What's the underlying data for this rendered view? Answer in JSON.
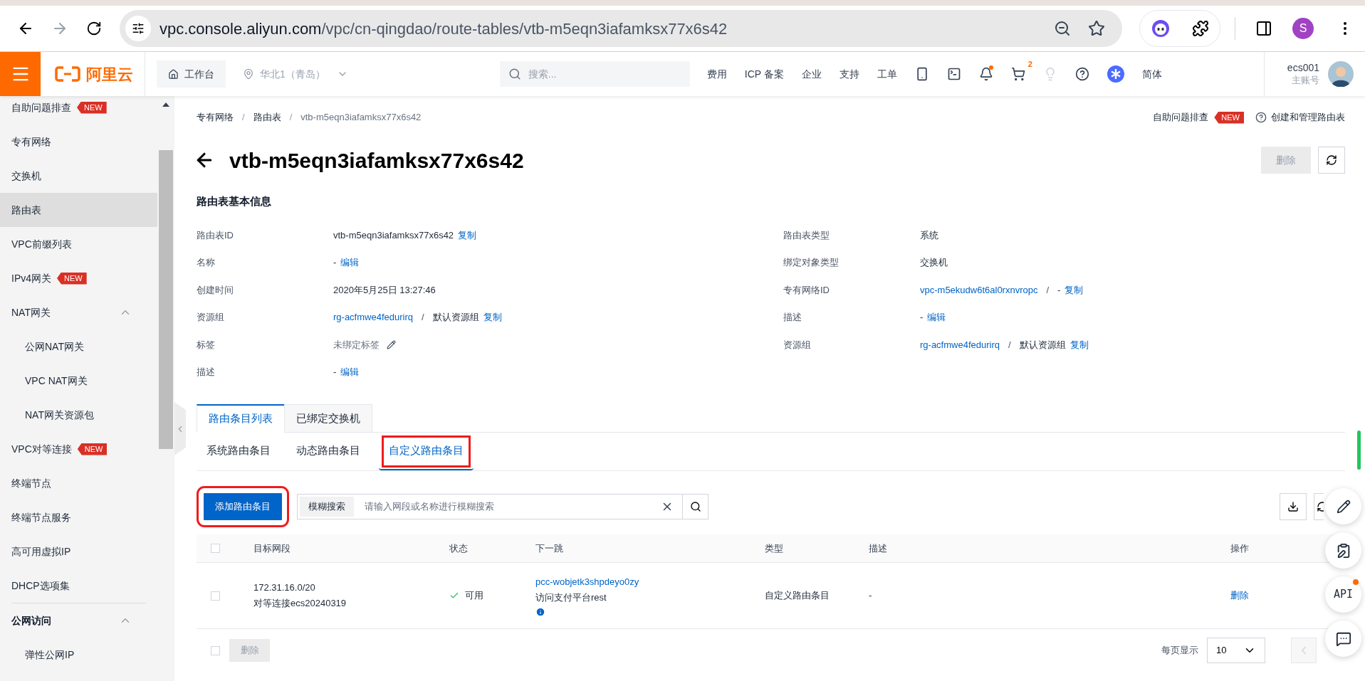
{
  "browser": {
    "url_host": "vpc.console.aliyun.com",
    "url_path": "/vpc/cn-qingdao/route-tables/vtb-m5eqn3iafamksx77x6s42",
    "forward_disabled": true,
    "profile_initial": "S"
  },
  "header": {
    "logo": "阿里云",
    "workbench": "工作台",
    "region": {
      "label": "华北1（青岛）",
      "disabled": true
    },
    "search_placeholder": "搜索...",
    "links": [
      "费用",
      "ICP 备案",
      "企业",
      "支持",
      "工单"
    ],
    "notification_dot": true,
    "cart_count": "2",
    "language": "简体",
    "user": {
      "name": "ecs001",
      "role": "主账号"
    }
  },
  "sidebar": {
    "items": [
      {
        "kind": "item",
        "label": "自助问题排查",
        "badge": "NEW",
        "selected": false
      },
      {
        "kind": "item",
        "label": "专有网络",
        "selected": false
      },
      {
        "kind": "item",
        "label": "交换机",
        "selected": false
      },
      {
        "kind": "item",
        "label": "路由表",
        "selected": true
      },
      {
        "kind": "item",
        "label": "VPC前缀列表",
        "selected": false
      },
      {
        "kind": "item",
        "label": "IPv4网关",
        "badge": "NEW",
        "selected": false
      },
      {
        "kind": "item",
        "label": "NAT网关",
        "selected": false,
        "expanded": true,
        "children": [
          {
            "label": "公网NAT网关",
            "selected": false
          },
          {
            "label": "VPC NAT网关",
            "selected": false
          },
          {
            "label": "NAT网关资源包",
            "selected": false
          }
        ]
      },
      {
        "kind": "item",
        "label": "VPC对等连接",
        "badge": "NEW",
        "selected": false
      },
      {
        "kind": "item",
        "label": "终端节点",
        "selected": false
      },
      {
        "kind": "item",
        "label": "终端节点服务",
        "selected": false
      },
      {
        "kind": "item",
        "label": "高可用虚拟IP",
        "selected": false
      },
      {
        "kind": "item",
        "label": "DHCP选项集",
        "selected": false
      },
      {
        "kind": "section",
        "label": "公网访问",
        "selected": false,
        "expanded": true,
        "children": [
          {
            "label": "弹性公网IP",
            "selected": false
          }
        ]
      }
    ]
  },
  "breadcrumb": [
    {
      "kind": "link",
      "text": "专有网络"
    },
    {
      "kind": "sep",
      "text": "/"
    },
    {
      "kind": "link",
      "text": "路由表"
    },
    {
      "kind": "sep",
      "text": "/"
    },
    {
      "kind": "current",
      "text": "vtb-m5eqn3iafamksx77x6s42"
    }
  ],
  "help": {
    "troubleshoot": "自助问题排查",
    "badge": "NEW",
    "guide": "创建和管理路由表"
  },
  "title": "vtb-m5eqn3iafamksx77x6s42",
  "delete_button": {
    "label": "删除",
    "disabled": true
  },
  "info": {
    "heading": "路由表基本信息",
    "left": [
      {
        "label": "路由表ID",
        "parts": [
          {
            "kind": "text",
            "text": "vtb-m5eqn3iafamksx77x6s42"
          },
          {
            "kind": "link",
            "text": "复制"
          }
        ]
      },
      {
        "label": "名称",
        "parts": [
          {
            "kind": "text",
            "text": "-"
          },
          {
            "kind": "link",
            "text": "编辑"
          }
        ]
      },
      {
        "label": "创建时间",
        "parts": [
          {
            "kind": "text",
            "text": "2020年5月25日 13:27:46"
          }
        ]
      },
      {
        "label": "资源组",
        "parts": [
          {
            "kind": "link",
            "text": "rg-acfmwe4fedurirq"
          },
          {
            "kind": "sep",
            "text": "/"
          },
          {
            "kind": "text",
            "text": "默认资源组"
          },
          {
            "kind": "link",
            "text": "复制"
          }
        ]
      },
      {
        "label": "标签",
        "parts": [
          {
            "kind": "muted",
            "text": "未绑定标签"
          },
          {
            "kind": "edit_icon"
          }
        ]
      },
      {
        "label": "描述",
        "parts": [
          {
            "kind": "text",
            "text": "-"
          },
          {
            "kind": "link",
            "text": "编辑"
          }
        ]
      }
    ],
    "right": [
      {
        "label": "路由表类型",
        "parts": [
          {
            "kind": "text",
            "text": "系统"
          }
        ]
      },
      {
        "label": "绑定对象类型",
        "parts": [
          {
            "kind": "text",
            "text": "交换机"
          }
        ]
      },
      {
        "label": "专有网络ID",
        "parts": [
          {
            "kind": "link",
            "text": "vpc-m5ekudw6t6al0rxnvropc"
          },
          {
            "kind": "sep",
            "text": "/"
          },
          {
            "kind": "text",
            "text": "-"
          },
          {
            "kind": "link",
            "text": "复制"
          }
        ]
      },
      {
        "label": "描述",
        "parts": [
          {
            "kind": "text",
            "text": "-"
          },
          {
            "kind": "link",
            "text": "编辑"
          }
        ]
      },
      {
        "label": "资源组",
        "parts": [
          {
            "kind": "link",
            "text": "rg-acfmwe4fedurirq"
          },
          {
            "kind": "sep",
            "text": "/"
          },
          {
            "kind": "text",
            "text": "默认资源组"
          },
          {
            "kind": "link",
            "text": "复制"
          }
        ]
      }
    ]
  },
  "tabs": [
    {
      "label": "路由条目列表",
      "selected": true
    },
    {
      "label": "已绑定交换机",
      "selected": false
    }
  ],
  "subtabs": [
    {
      "label": "系统路由条目",
      "selected": false,
      "highlighted": false
    },
    {
      "label": "动态路由条目",
      "selected": false,
      "highlighted": false
    },
    {
      "label": "自定义路由条目",
      "selected": true,
      "highlighted": true
    }
  ],
  "toolbar": {
    "add_button": {
      "label": "添加路由条目",
      "highlighted": true
    },
    "search_label": "模糊搜索",
    "search_placeholder": "请输入网段或名称进行模糊搜索"
  },
  "table": {
    "all_checked": false,
    "columns": [
      "目标网段",
      "状态",
      "下一跳",
      "类型",
      "描述",
      "操作"
    ],
    "rows": [
      {
        "checked": false,
        "cidr": "172.31.16.0/20",
        "name": "对等连接ecs20240319",
        "status": "可用",
        "next_hop_id": "pcc-wobjetk3shpdeyo0zy",
        "next_hop_name": "访问支付平台rest",
        "type": "自定义路由条目",
        "description": "-",
        "action": "删除"
      }
    ]
  },
  "footer": {
    "all_checked": false,
    "delete": {
      "label": "删除",
      "disabled": true
    },
    "page_size_label": "每页显示",
    "page_size": "10",
    "prev_disabled": true
  },
  "float_buttons": [
    {
      "kind": "edit"
    },
    {
      "kind": "feedback"
    },
    {
      "kind": "api",
      "label": "API",
      "dot": true
    },
    {
      "kind": "chat"
    }
  ]
}
